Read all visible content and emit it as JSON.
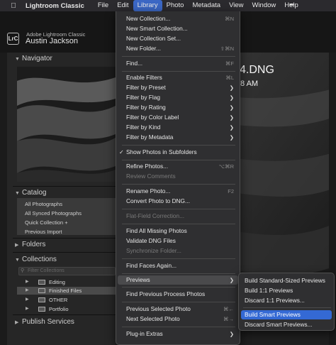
{
  "menubar": {
    "app_name": "Lightroom Classic",
    "items": [
      "File",
      "Edit",
      "Library",
      "Photo",
      "Metadata",
      "View",
      "Window",
      "Help"
    ],
    "active": "Library",
    "extra_icon": "pen-nib-icon"
  },
  "identity": {
    "logo": "LrC",
    "product": "Adobe Lightroom Classic",
    "user": "Austin Jackson"
  },
  "left_panel": {
    "navigator": "Navigator",
    "catalog": "Catalog",
    "catalog_items": [
      "All Photographs",
      "All Synced Photographs",
      "Quick Collection +",
      "Previous Import"
    ],
    "folders": "Folders",
    "collections": "Collections",
    "collections_filter_placeholder": "Filter Collections",
    "collection_items": [
      {
        "label": "Editing",
        "selected": false
      },
      {
        "label": "Finished Files",
        "selected": true
      },
      {
        "label": "OTHER",
        "selected": false
      },
      {
        "label": "Portfolio",
        "selected": false
      }
    ],
    "publish_services": "Publish Services"
  },
  "photo": {
    "title": "4.DNG",
    "time": "8 AM"
  },
  "library_menu": {
    "items": [
      {
        "label": "New Collection...",
        "shortcut": "⌘N"
      },
      {
        "label": "New Smart Collection..."
      },
      {
        "label": "New Collection Set..."
      },
      {
        "label": "New Folder...",
        "shortcut": "⇧⌘N"
      },
      {
        "label": "Find...",
        "shortcut": "⌘F"
      },
      {
        "label": "Enable Filters",
        "shortcut": "⌘L"
      },
      {
        "label": "Filter by Preset",
        "submenu": true
      },
      {
        "label": "Filter by Flag",
        "submenu": true
      },
      {
        "label": "Filter by Rating",
        "submenu": true
      },
      {
        "label": "Filter by Color Label",
        "submenu": true
      },
      {
        "label": "Filter by Kind",
        "submenu": true
      },
      {
        "label": "Filter by Metadata",
        "submenu": true
      },
      {
        "label": "Show Photos in Subfolders",
        "checked": true
      },
      {
        "label": "Refine Photos...",
        "shortcut": "⌥⌘R"
      },
      {
        "label": "Review Comments",
        "disabled": true
      },
      {
        "label": "Rename Photo...",
        "shortcut": "F2"
      },
      {
        "label": "Convert Photo to DNG..."
      },
      {
        "label": "Flat-Field Correction...",
        "disabled": true
      },
      {
        "label": "Find All Missing Photos"
      },
      {
        "label": "Validate DNG Files"
      },
      {
        "label": "Synchronize Folder...",
        "disabled": true
      },
      {
        "label": "Find Faces Again..."
      },
      {
        "label": "Previews",
        "submenu": true,
        "highlighted": true
      },
      {
        "label": "Find Previous Process Photos"
      },
      {
        "label": "Previous Selected Photo",
        "shortcut": "⌘←"
      },
      {
        "label": "Next Selected Photo",
        "shortcut": "⌘→"
      },
      {
        "label": "Plug-in Extras",
        "submenu": true
      }
    ]
  },
  "previews_submenu": {
    "items": [
      {
        "label": "Build Standard-Sized Previews"
      },
      {
        "label": "Build 1:1 Previews"
      },
      {
        "label": "Discard 1:1 Previews..."
      },
      {
        "label": "Build Smart Previews",
        "selected": true
      },
      {
        "label": "Discard Smart Previews..."
      }
    ]
  },
  "colors": {
    "menu_bg": "#2f2f31",
    "selection_blue": "#3469d4",
    "menubar_active": "#3b67c4"
  }
}
